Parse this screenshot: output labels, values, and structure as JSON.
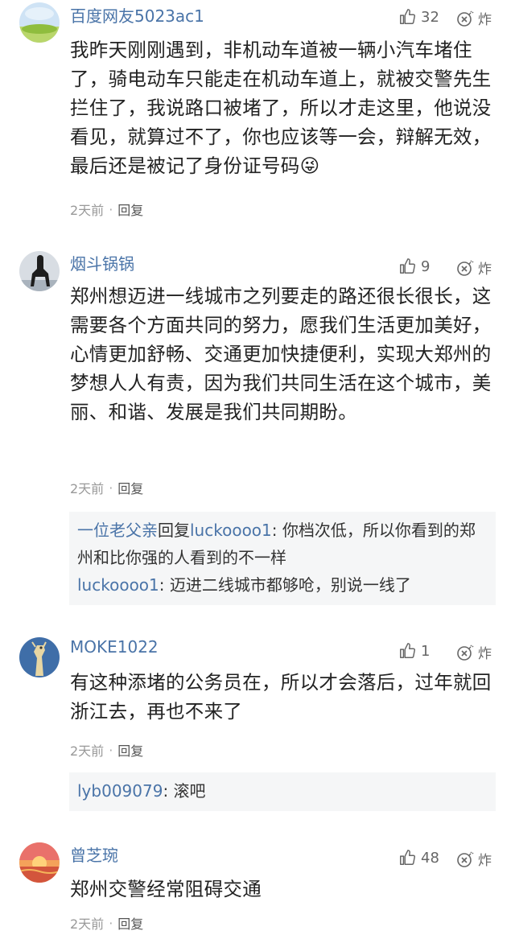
{
  "comments": [
    {
      "username": "百度网友5023ac1",
      "likes": "32",
      "bomb_label": "炸",
      "text": "我昨天刚刚遇到，非机动车道被一辆小汽车堵住了，骑电动车只能走在机动车道上，就被交警先生拦住了，我说路口被堵了，所以才走这里，他说没看见，就算过不了，你也应该等一会，辩解无效，最后还是被记了身份证号码😜",
      "time": "2天前",
      "separator": "·",
      "reply_label": "回复"
    },
    {
      "username": "烟斗锅锅",
      "likes": "9",
      "bomb_label": "炸",
      "text": "郑州想迈进一线城市之列要走的路还很长很长，这需要各个方面共同的努力，愿我们生活更加美好，心情更加舒畅、交通更加快捷便利，实现大郑州的梦想人人有责，因为我们共同生活在这个城市，美丽、和谐、发展是我们共同期盼。",
      "time": "2天前",
      "separator": "·",
      "reply_label": "回复",
      "replies": [
        {
          "from": "一位老父亲",
          "verb": "回复",
          "to": "luckoooo1",
          "colon": ": ",
          "text": "你档次低，所以你看到的郑州和比你强的人看到的不一样"
        },
        {
          "from": "luckoooo1",
          "colon": ": ",
          "text": "迈进二线城市都够呛，别说一线了"
        }
      ]
    },
    {
      "username": "MOKE1022",
      "likes": "1",
      "bomb_label": "炸",
      "text": "有这种添堵的公务员在，所以才会落后，过年就回浙江去，再也不来了",
      "time": "2天前",
      "separator": "·",
      "reply_label": "回复",
      "replies": [
        {
          "from": "lyb009079",
          "colon": ": ",
          "text": "滚吧"
        }
      ]
    },
    {
      "username": "曾芝琬",
      "likes": "48",
      "bomb_label": "炸",
      "text": "郑州交警经常阻碍交通",
      "time": "2天前",
      "separator": "·",
      "reply_label": "回复"
    }
  ],
  "icons": {
    "like": "thumbs-up-icon",
    "bomb": "bomb-icon"
  },
  "colors": {
    "username": "#4a74a8",
    "body_text": "#222222",
    "meta": "#999999",
    "reply_bg": "#f5f6f7"
  }
}
